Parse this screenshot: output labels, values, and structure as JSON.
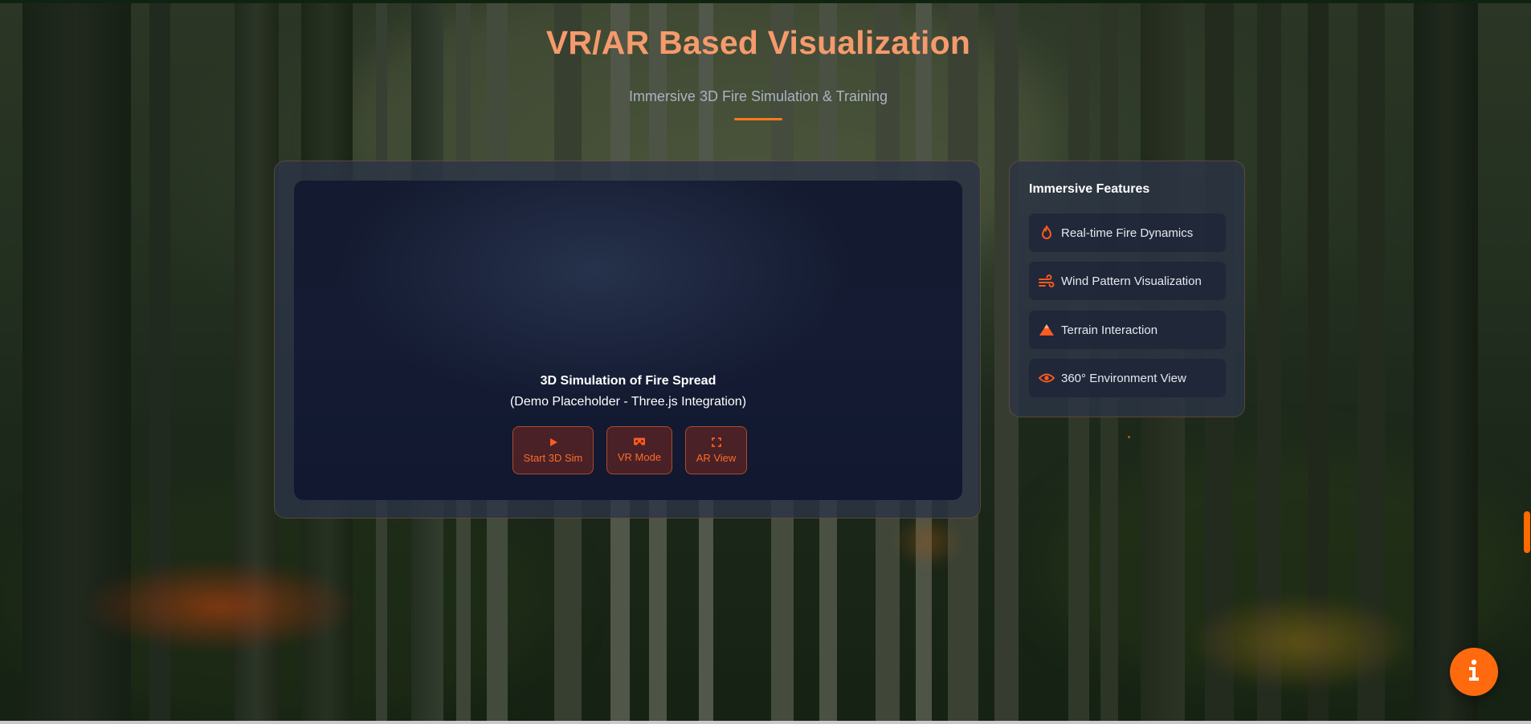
{
  "header": {
    "title": "VR/AR Based Visualization",
    "subtitle": "Immersive 3D Fire Simulation & Training"
  },
  "simulation": {
    "title": "3D Simulation of Fire Spread",
    "subtitle": "(Demo Placeholder - Three.js Integration)",
    "buttons": [
      {
        "label": "Start 3D Sim",
        "icon": "play-icon"
      },
      {
        "label": "VR Mode",
        "icon": "vr-headset-icon"
      },
      {
        "label": "AR View",
        "icon": "expand-icon"
      }
    ]
  },
  "features": {
    "title": "Immersive Features",
    "items": [
      {
        "label": "Real-time Fire Dynamics",
        "icon": "fire-icon"
      },
      {
        "label": "Wind Pattern Visualization",
        "icon": "wind-icon"
      },
      {
        "label": "Terrain Interaction",
        "icon": "mountain-icon"
      },
      {
        "label": "360° Environment View",
        "icon": "eye-icon"
      }
    ]
  },
  "info_button": {
    "icon": "info-icon"
  },
  "colors": {
    "accent": "#ff6a0e",
    "title": "#f59a6c",
    "panel": "#2c3446",
    "canvas": "#141b30"
  }
}
